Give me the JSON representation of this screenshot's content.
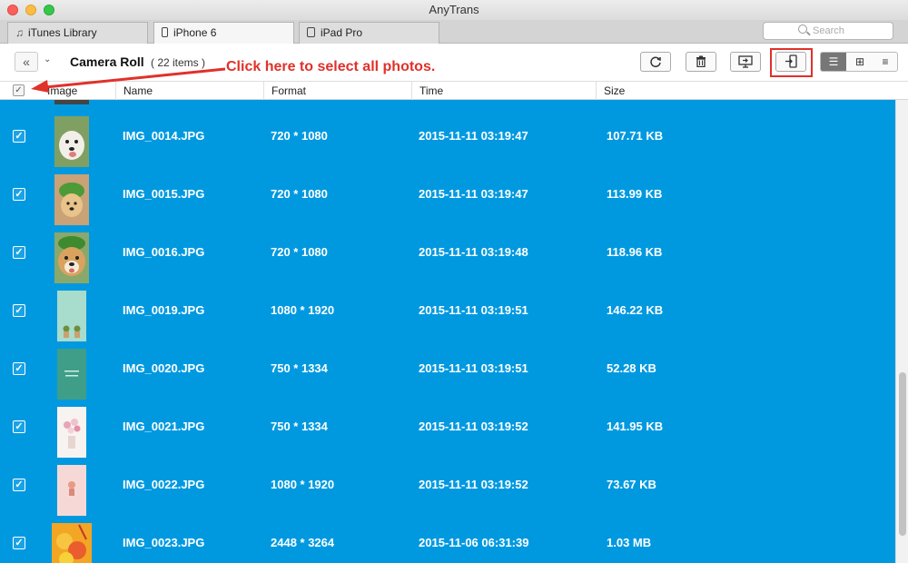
{
  "window": {
    "title": "AnyTrans"
  },
  "tabs": [
    {
      "label": "iTunes Library",
      "icon": "music-note-icon"
    },
    {
      "label": "iPhone 6",
      "icon": "iphone-icon"
    },
    {
      "label": "iPad Pro",
      "icon": "ipad-icon"
    }
  ],
  "search": {
    "placeholder": "Search"
  },
  "toolbar": {
    "album_title": "Camera Roll",
    "album_count": "( 22 items )",
    "buttons": [
      "refresh-icon",
      "trash-icon",
      "to-computer-icon",
      "to-device-icon"
    ],
    "views": [
      "list-view-icon",
      "grid-view-icon",
      "detail-view-icon"
    ]
  },
  "annotation": {
    "text": "Click here to select all photos."
  },
  "columns": [
    "Image",
    "Name",
    "Format",
    "Time",
    "Size"
  ],
  "rows": [
    {
      "name": "IMG_0014.JPG",
      "format": "720 * 1080",
      "time": "2015-11-11 03:19:47",
      "size": "107.71 KB"
    },
    {
      "name": "IMG_0015.JPG",
      "format": "720 * 1080",
      "time": "2015-11-11 03:19:47",
      "size": "113.99 KB"
    },
    {
      "name": "IMG_0016.JPG",
      "format": "720 * 1080",
      "time": "2015-11-11 03:19:48",
      "size": "118.96 KB"
    },
    {
      "name": "IMG_0019.JPG",
      "format": "1080 * 1920",
      "time": "2015-11-11 03:19:51",
      "size": "146.22 KB"
    },
    {
      "name": "IMG_0020.JPG",
      "format": "750 * 1334",
      "time": "2015-11-11 03:19:51",
      "size": "52.28 KB"
    },
    {
      "name": "IMG_0021.JPG",
      "format": "750 * 1334",
      "time": "2015-11-11 03:19:52",
      "size": "141.95 KB"
    },
    {
      "name": "IMG_0022.JPG",
      "format": "1080 * 1920",
      "time": "2015-11-11 03:19:52",
      "size": "73.67 KB"
    },
    {
      "name": "IMG_0023.JPG",
      "format": "2448 * 3264",
      "time": "2015-11-06 06:31:39",
      "size": "1.03 MB"
    }
  ],
  "colors": {
    "selection": "#0099e0",
    "annotation": "#e0312a"
  }
}
